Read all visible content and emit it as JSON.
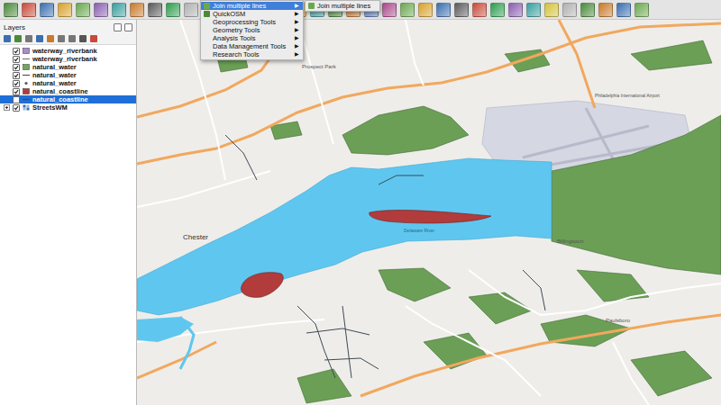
{
  "layers_panel": {
    "title": "Layers",
    "items": [
      {
        "label": "waterway_riverbank",
        "checked": true,
        "selected": false,
        "kind": "fill",
        "color": "#a98ccf"
      },
      {
        "label": "waterway_riverbank",
        "checked": true,
        "selected": false,
        "kind": "line",
        "color": "#7a7a7a"
      },
      {
        "label": "natural_water",
        "checked": true,
        "selected": false,
        "kind": "fill",
        "color": "#6fa85a"
      },
      {
        "label": "natural_water",
        "checked": true,
        "selected": false,
        "kind": "line",
        "color": "#555555"
      },
      {
        "label": "natural_water",
        "checked": true,
        "selected": false,
        "kind": "point",
        "color": "#555555"
      },
      {
        "label": "natural_coastline",
        "checked": true,
        "selected": false,
        "kind": "fill",
        "color": "#b23b3b"
      },
      {
        "label": "natural_coastline",
        "checked": false,
        "selected": true,
        "kind": "line",
        "color": "#4a4a4a"
      },
      {
        "label": "StreetsWM",
        "checked": true,
        "selected": false,
        "kind": "group",
        "color": "#3b6fb0"
      }
    ]
  },
  "menu": {
    "items": [
      {
        "label": "Join multiple lines",
        "arrow": "▶",
        "highlighted": true
      },
      {
        "label": "QuickOSM",
        "arrow": "▶",
        "highlighted": false
      },
      {
        "label": "Geoprocessing Tools",
        "arrow": "▶",
        "highlighted": false
      },
      {
        "label": "Geometry Tools",
        "arrow": "▶",
        "highlighted": false
      },
      {
        "label": "Analysis Tools",
        "arrow": "▶",
        "highlighted": false
      },
      {
        "label": "Data Management Tools",
        "arrow": "▶",
        "highlighted": false
      },
      {
        "label": "Research Tools",
        "arrow": "▶",
        "highlighted": false
      }
    ]
  },
  "submenu": {
    "items": [
      "Join multiple lines"
    ]
  },
  "map": {
    "labels": [
      "Chester",
      "Prospect Park",
      "Delaware River",
      "Billingsport",
      "Paulsboro",
      "Philadelphia International Airport"
    ]
  }
}
